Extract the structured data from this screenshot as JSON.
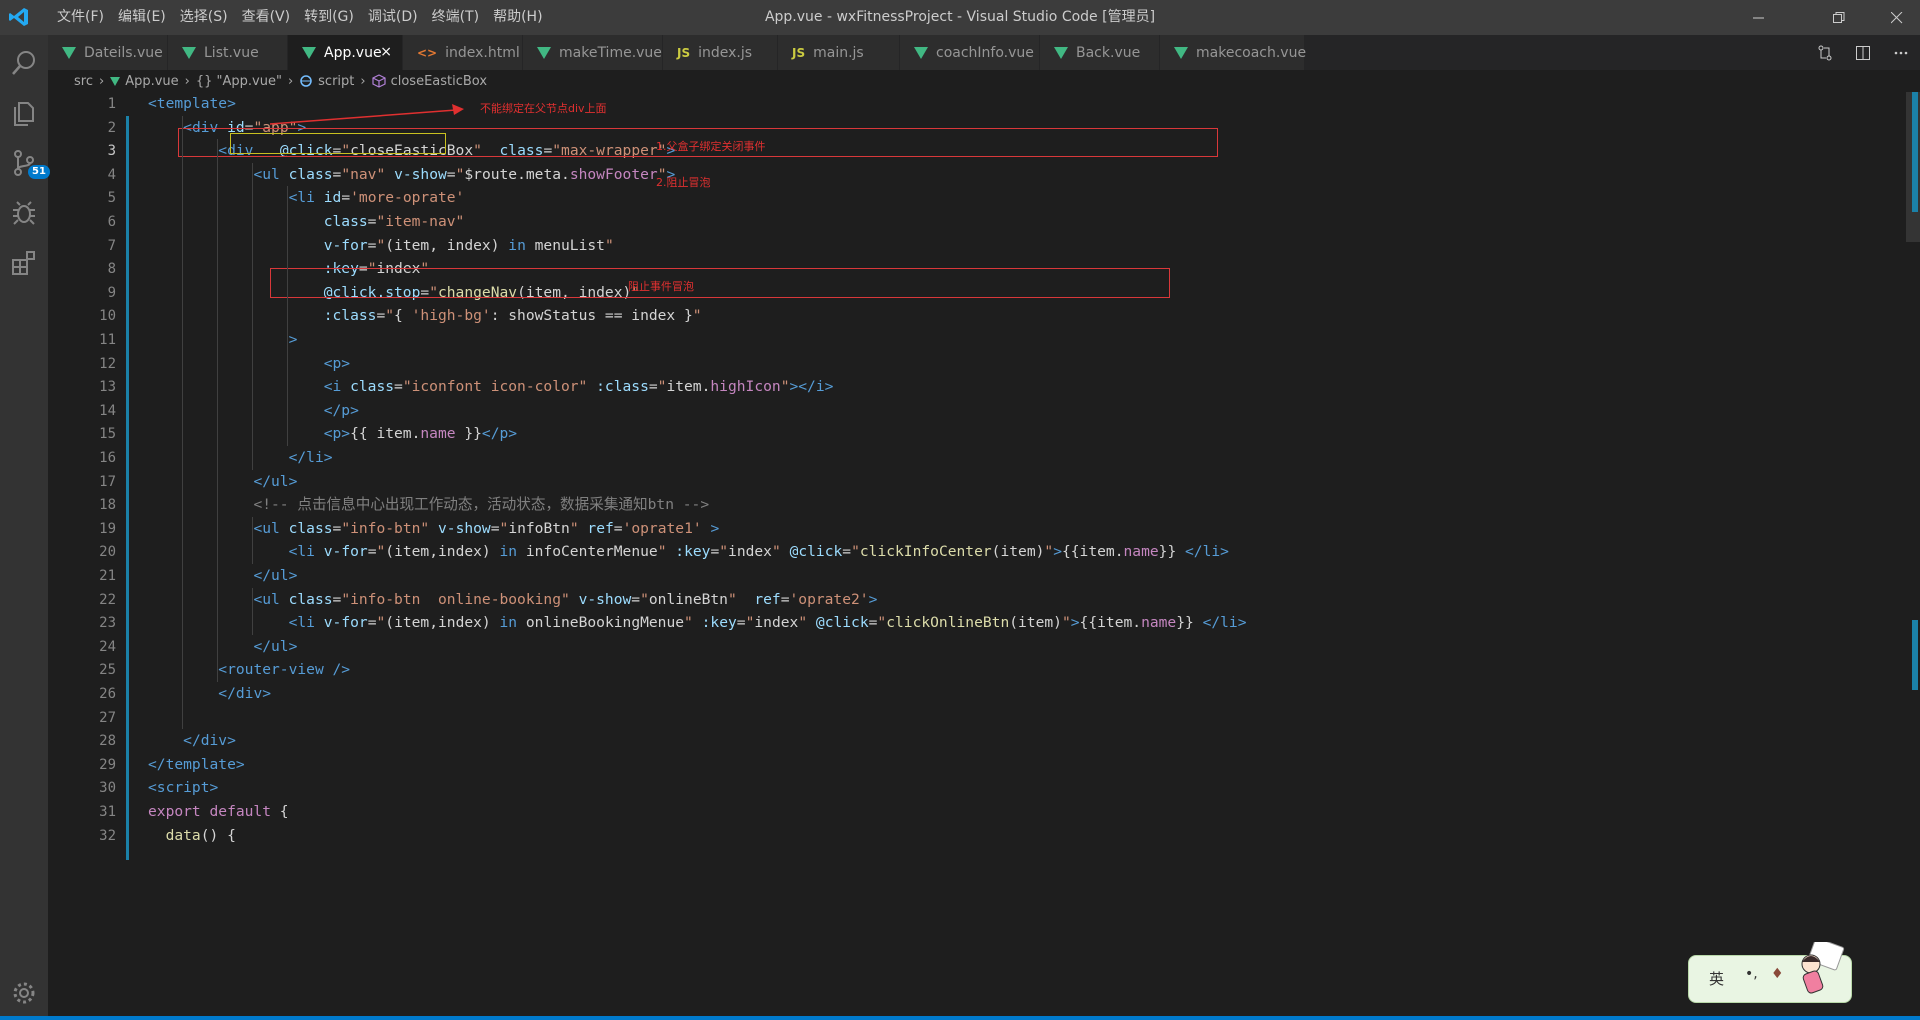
{
  "window": {
    "title": "App.vue - wxFitnessProject - Visual Studio Code [管理员]",
    "menu": [
      "文件(F)",
      "编辑(E)",
      "选择(S)",
      "查看(V)",
      "转到(G)",
      "调试(D)",
      "终端(T)",
      "帮助(H)"
    ]
  },
  "activity": {
    "source_control_badge": "51"
  },
  "tabs": [
    {
      "label": "Dateils.vue",
      "icon": "vue-icon"
    },
    {
      "label": "List.vue",
      "icon": "vue-icon"
    },
    {
      "label": "App.vue",
      "icon": "vue-icon",
      "active": true,
      "close": "×"
    },
    {
      "label": "index.html",
      "icon": "html-icon",
      "glyph": "<>"
    },
    {
      "label": "makeTime.vue",
      "icon": "vue-icon"
    },
    {
      "label": "index.js",
      "icon": "js-icon",
      "glyph": "JS"
    },
    {
      "label": "main.js",
      "icon": "js-icon",
      "glyph": "JS"
    },
    {
      "label": "coachInfo.vue",
      "icon": "vue-icon"
    },
    {
      "label": "Back.vue",
      "icon": "vue-icon"
    },
    {
      "label": "makecoach.vue",
      "icon": "vue-icon"
    }
  ],
  "breadcrumb": {
    "items": [
      "src",
      "App.vue",
      "{} \"App.vue\"",
      "script",
      "closeEasticBox"
    ]
  },
  "editor": {
    "line_numbers": [
      "1",
      "2",
      "3",
      "4",
      "5",
      "6",
      "7",
      "8",
      "9",
      "10",
      "11",
      "12",
      "13",
      "14",
      "15",
      "16",
      "17",
      "18",
      "19",
      "20",
      "21",
      "22",
      "23",
      "24",
      "25",
      "26",
      "27",
      "28",
      "29",
      "30",
      "31",
      "32"
    ],
    "lines": [
      [
        [
          "t",
          "<template>"
        ]
      ],
      [
        [
          "d",
          "    "
        ],
        [
          "t",
          "<div "
        ],
        [
          "a",
          "id"
        ],
        [
          "d",
          "="
        ],
        [
          "s",
          "\"app\""
        ],
        [
          "t",
          ">"
        ]
      ],
      [
        [
          "d",
          "        "
        ],
        [
          "t",
          "<div "
        ],
        [
          "d",
          "  "
        ],
        [
          "a",
          "@click"
        ],
        [
          "d",
          "="
        ],
        [
          "s",
          "\""
        ],
        [
          "d",
          "closeEasticBox"
        ],
        [
          "s",
          "\""
        ],
        [
          "d",
          "  "
        ],
        [
          "a",
          "class"
        ],
        [
          "d",
          "="
        ],
        [
          "s",
          "\"max-wrapper\""
        ],
        [
          "t",
          ">"
        ]
      ],
      [
        [
          "d",
          "            "
        ],
        [
          "t",
          "<ul "
        ],
        [
          "a",
          "class"
        ],
        [
          "d",
          "="
        ],
        [
          "s",
          "\"nav\""
        ],
        [
          "d",
          " "
        ],
        [
          "a",
          "v-show"
        ],
        [
          "d",
          "="
        ],
        [
          "s",
          "\""
        ],
        [
          "d",
          "$route.meta."
        ],
        [
          "k",
          "showFooter"
        ],
        [
          "s",
          "\""
        ],
        [
          "t",
          ">"
        ]
      ],
      [
        [
          "d",
          "                "
        ],
        [
          "t",
          "<li "
        ],
        [
          "a",
          "id"
        ],
        [
          "d",
          "="
        ],
        [
          "s",
          "'more-oprate'"
        ]
      ],
      [
        [
          "d",
          "                    "
        ],
        [
          "a",
          "class"
        ],
        [
          "d",
          "="
        ],
        [
          "s",
          "\"item-nav\""
        ]
      ],
      [
        [
          "d",
          "                    "
        ],
        [
          "a",
          "v-for"
        ],
        [
          "d",
          "="
        ],
        [
          "s",
          "\""
        ],
        [
          "d",
          "(item, index) "
        ],
        [
          "t",
          "in"
        ],
        [
          "d",
          " menuList"
        ],
        [
          "s",
          "\""
        ]
      ],
      [
        [
          "d",
          "                    "
        ],
        [
          "a",
          ":key"
        ],
        [
          "d",
          "="
        ],
        [
          "s",
          "\""
        ],
        [
          "d",
          "index"
        ],
        [
          "s",
          "\""
        ]
      ],
      [
        [
          "d",
          "                    "
        ],
        [
          "a",
          "@click.stop"
        ],
        [
          "d",
          "="
        ],
        [
          "s",
          "\""
        ],
        [
          "f",
          "changeNav"
        ],
        [
          "d",
          "(item, index)"
        ],
        [
          "s",
          "\""
        ]
      ],
      [
        [
          "d",
          "                    "
        ],
        [
          "a",
          ":class"
        ],
        [
          "d",
          "="
        ],
        [
          "s",
          "\""
        ],
        [
          "d",
          "{ "
        ],
        [
          "s",
          "'high-bg'"
        ],
        [
          "d",
          ": showStatus == index }"
        ],
        [
          "s",
          "\""
        ]
      ],
      [
        [
          "d",
          "                "
        ],
        [
          "t",
          ">"
        ]
      ],
      [
        [
          "d",
          "                    "
        ],
        [
          "t",
          "<p>"
        ]
      ],
      [
        [
          "d",
          "                    "
        ],
        [
          "t",
          "<i "
        ],
        [
          "a",
          "class"
        ],
        [
          "d",
          "="
        ],
        [
          "s",
          "\"iconfont icon-color\""
        ],
        [
          "d",
          " "
        ],
        [
          "a",
          ":class"
        ],
        [
          "d",
          "="
        ],
        [
          "s",
          "\""
        ],
        [
          "d",
          "item."
        ],
        [
          "k",
          "highIcon"
        ],
        [
          "s",
          "\""
        ],
        [
          "t",
          "></i>"
        ]
      ],
      [
        [
          "d",
          "                    "
        ],
        [
          "t",
          "</p>"
        ]
      ],
      [
        [
          "d",
          "                    "
        ],
        [
          "t",
          "<p>"
        ],
        [
          "d",
          "{{ item."
        ],
        [
          "k",
          "name"
        ],
        [
          "d",
          " }}"
        ],
        [
          "t",
          "</p>"
        ]
      ],
      [
        [
          "d",
          "                "
        ],
        [
          "t",
          "</li>"
        ]
      ],
      [
        [
          "d",
          "            "
        ],
        [
          "t",
          "</ul>"
        ]
      ],
      [
        [
          "d",
          "            "
        ],
        [
          "p",
          "<!-- 点击信息中心出现工作动态，活动状态，数据采集通知btn -->"
        ]
      ],
      [
        [
          "d",
          "            "
        ],
        [
          "t",
          "<ul "
        ],
        [
          "a",
          "class"
        ],
        [
          "d",
          "="
        ],
        [
          "s",
          "\"info-btn\""
        ],
        [
          "d",
          " "
        ],
        [
          "a",
          "v-show"
        ],
        [
          "d",
          "="
        ],
        [
          "s",
          "\""
        ],
        [
          "d",
          "infoBtn"
        ],
        [
          "s",
          "\""
        ],
        [
          "d",
          " "
        ],
        [
          "a",
          "ref"
        ],
        [
          "d",
          "="
        ],
        [
          "s",
          "'oprate1'"
        ],
        [
          "d",
          " "
        ],
        [
          "t",
          ">"
        ]
      ],
      [
        [
          "d",
          "                "
        ],
        [
          "t",
          "<li "
        ],
        [
          "a",
          "v-for"
        ],
        [
          "d",
          "="
        ],
        [
          "s",
          "\""
        ],
        [
          "d",
          "(item,index) "
        ],
        [
          "t",
          "in"
        ],
        [
          "d",
          " infoCenterMenue"
        ],
        [
          "s",
          "\""
        ],
        [
          "d",
          " "
        ],
        [
          "a",
          ":key"
        ],
        [
          "d",
          "="
        ],
        [
          "s",
          "\""
        ],
        [
          "d",
          "index"
        ],
        [
          "s",
          "\""
        ],
        [
          "d",
          " "
        ],
        [
          "a",
          "@click"
        ],
        [
          "d",
          "="
        ],
        [
          "s",
          "\""
        ],
        [
          "f",
          "clickInfoCenter"
        ],
        [
          "d",
          "(item)"
        ],
        [
          "s",
          "\""
        ],
        [
          "t",
          ">"
        ],
        [
          "d",
          "{{item."
        ],
        [
          "k",
          "name"
        ],
        [
          "d",
          "}} "
        ],
        [
          "t",
          "</li>"
        ]
      ],
      [
        [
          "d",
          "            "
        ],
        [
          "t",
          "</ul>"
        ]
      ],
      [
        [
          "d",
          "            "
        ],
        [
          "t",
          "<ul "
        ],
        [
          "a",
          "class"
        ],
        [
          "d",
          "="
        ],
        [
          "s",
          "\"info-btn  online-booking\""
        ],
        [
          "d",
          " "
        ],
        [
          "a",
          "v-show"
        ],
        [
          "d",
          "="
        ],
        [
          "s",
          "\""
        ],
        [
          "d",
          "onlineBtn"
        ],
        [
          "s",
          "\""
        ],
        [
          "d",
          "  "
        ],
        [
          "a",
          "ref"
        ],
        [
          "d",
          "="
        ],
        [
          "s",
          "'oprate2'"
        ],
        [
          "t",
          ">"
        ]
      ],
      [
        [
          "d",
          "                "
        ],
        [
          "t",
          "<li "
        ],
        [
          "a",
          "v-for"
        ],
        [
          "d",
          "="
        ],
        [
          "s",
          "\""
        ],
        [
          "d",
          "(item,index) "
        ],
        [
          "t",
          "in"
        ],
        [
          "d",
          " onlineBookingMenue"
        ],
        [
          "s",
          "\""
        ],
        [
          "d",
          " "
        ],
        [
          "a",
          ":key"
        ],
        [
          "d",
          "="
        ],
        [
          "s",
          "\""
        ],
        [
          "d",
          "index"
        ],
        [
          "s",
          "\""
        ],
        [
          "d",
          " "
        ],
        [
          "a",
          "@click"
        ],
        [
          "d",
          "="
        ],
        [
          "s",
          "\""
        ],
        [
          "f",
          "clickOnlineBtn"
        ],
        [
          "d",
          "(item)"
        ],
        [
          "s",
          "\""
        ],
        [
          "t",
          ">"
        ],
        [
          "d",
          "{{item."
        ],
        [
          "k",
          "name"
        ],
        [
          "d",
          "}} "
        ],
        [
          "t",
          "</li>"
        ]
      ],
      [
        [
          "d",
          "            "
        ],
        [
          "t",
          "</ul>"
        ]
      ],
      [
        [
          "d",
          "        "
        ],
        [
          "t",
          "<router-view />"
        ]
      ],
      [
        [
          "d",
          "        "
        ],
        [
          "t",
          "</div>"
        ]
      ],
      [
        [
          "d",
          ""
        ]
      ],
      [
        [
          "d",
          "    "
        ],
        [
          "t",
          "</div>"
        ]
      ],
      [
        [
          "t",
          "</template>"
        ]
      ],
      [
        [
          "t",
          "<script>"
        ]
      ],
      [
        [
          "k",
          "export default"
        ],
        [
          "d",
          " {"
        ]
      ],
      [
        [
          "d",
          "  "
        ],
        [
          "f",
          "data"
        ],
        [
          "d",
          "() {"
        ]
      ]
    ]
  },
  "annotations": {
    "note1": "不能绑定在父节点div上面",
    "note2": "1.父盒子绑定关闭事件",
    "note3": "2.阻止冒泡",
    "note4": "阻止事件冒泡"
  },
  "ime": {
    "label": "英"
  },
  "colors": {
    "annotation_red": "#d9383a",
    "annotation_yellow": "#c8c020",
    "accent": "#007acc",
    "vue_green": "#41b883"
  }
}
